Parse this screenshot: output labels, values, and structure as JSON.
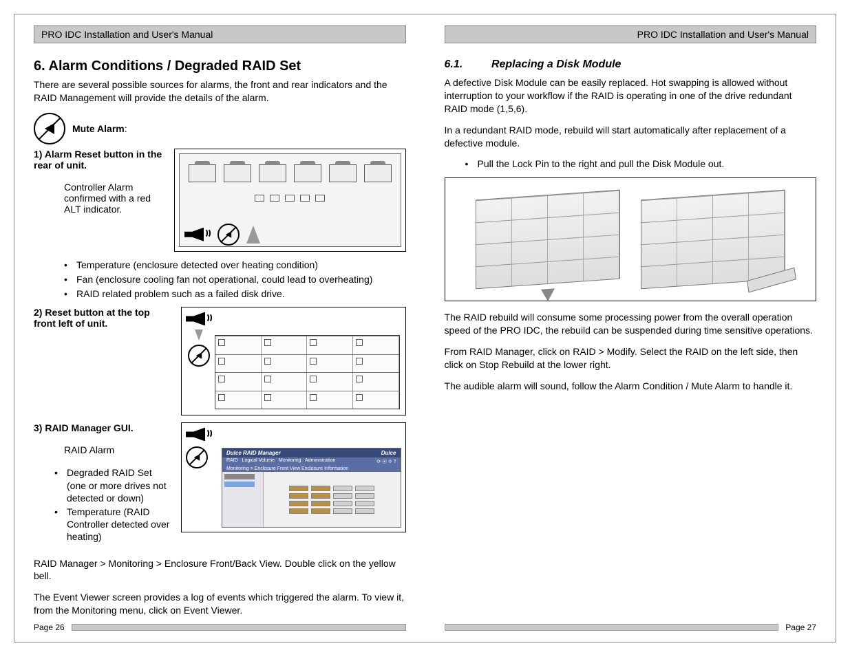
{
  "header": {
    "left": "PRO IDC Installation and User's Manual",
    "right": "PRO IDC Installation and User's Manual"
  },
  "left_page": {
    "title": "6. Alarm Conditions / Degraded RAID Set",
    "intro": "There are several possible sources for alarms, the front and rear indicators and the RAID Management will provide the details of the alarm.",
    "mute_label": "Mute Alarm",
    "item1_label": "1)  Alarm Reset button in the rear of unit.",
    "item1_sub": "Controller Alarm confirmed with a red ALT indicator.",
    "bullets1": [
      "Temperature (enclosure detected over heating condition)",
      "Fan (enclosure cooling fan not operational, could lead to overheating)",
      "RAID related problem such as a failed disk drive."
    ],
    "item2_label": "2)  Reset button at the top front left of unit.",
    "item3_label": "3)  RAID Manager GUI.",
    "item3_sub": "RAID Alarm",
    "bullets3": [
      "Degraded RAID Set (one or more drives not detected or down)",
      "Temperature (RAID Controller detected over heating)"
    ],
    "nav_text": "RAID Manager  > Monitoring > Enclosure Front/Back View.  Double click on the yellow bell.",
    "event_text": "The Event Viewer screen provides a log of events which triggered the alarm.  To view it, from the Monitoring menu, click on Event Viewer.",
    "page_num": "Page 26",
    "gui_title": "Dulce RAID Manager",
    "gui_brand": "Dulce",
    "gui_breadcrumb": "Monitoring > Enclosure Front View  Enclosure Information"
  },
  "right_page": {
    "sub_num": "6.1.",
    "sub_title": "Replacing a Disk Module",
    "p1": "A defective Disk Module can be easily replaced.  Hot swapping is allowed without interruption to your workflow if the RAID is operating in one of the drive redundant RAID mode (1,5,6).",
    "p2": "In a redundant RAID mode, rebuild will start automatically after replacement of a defective module.",
    "bullet": "Pull the Lock Pin to the right and pull the Disk Module out.",
    "p3": "The RAID rebuild will consume some processing power from the overall operation speed of the PRO IDC, the rebuild can be suspended during time sensitive operations.",
    "p4": "From RAID Manager, click on RAID > Modify.  Select the RAID on the left side, then click on Stop Rebuild at the lower right.",
    "p5": "The audible alarm will sound, follow the Alarm Condition / Mute Alarm to handle it.",
    "page_num": "Page 27"
  }
}
